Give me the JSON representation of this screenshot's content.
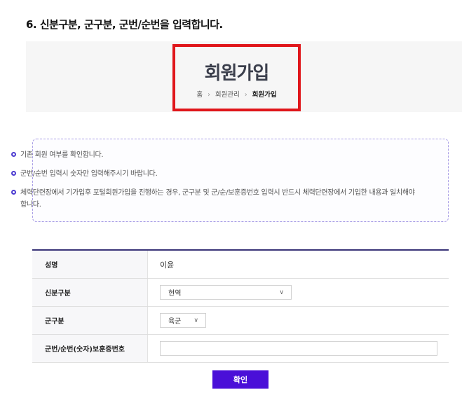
{
  "step_title": "6. 신분구분, 군구분, 군번/순번을 입력합니다.",
  "banner": {
    "title": "회원가입",
    "breadcrumb": [
      "홈",
      "회원관리",
      "회원가입"
    ],
    "separator": "›"
  },
  "notice": {
    "items": [
      "기존 회원 여부를 확인합니다.",
      "군번/순번 입력시 숫자만 입력해주시기 바랍니다.",
      "체력단련장에서 기가입후 포털회원가입을 진행하는 경우, 군구분 및 군/순/보훈증번호 입력시 반드시 체력단련장에서 기입한 내용과 일치해야 합니다."
    ]
  },
  "form": {
    "name_label": "성명",
    "name_value": "이윤",
    "status_label": "신분구분",
    "status_value": "현역",
    "branch_label": "군구분",
    "branch_value": "육군",
    "number_label": "군번/순번(숫자)보훈증번호",
    "number_value": ""
  },
  "confirm_label": "확인",
  "colors": {
    "highlight": "#e0161b",
    "accent": "#4a0fd8",
    "table_top": "#3a3478"
  }
}
